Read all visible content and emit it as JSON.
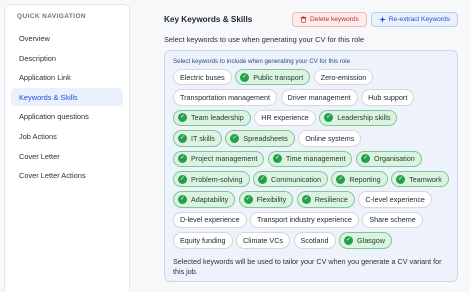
{
  "sidebar": {
    "heading": "QUICK NAVIGATION",
    "items": [
      {
        "label": "Overview"
      },
      {
        "label": "Description"
      },
      {
        "label": "Application Link"
      },
      {
        "label": "Keywords & Skills",
        "active": true
      },
      {
        "label": "Application questions"
      },
      {
        "label": "Job Actions"
      },
      {
        "label": "Cover Letter"
      },
      {
        "label": "Cover Letter Actions"
      }
    ]
  },
  "main": {
    "title": "Key Keywords & Skills",
    "delete_label": "Delete keywords",
    "reextract_label": "Re-extract Keywords",
    "subtitle": "Select keywords to use when generating your CV for this role",
    "panel_caption": "Select keywords to include when generating your CV for this role",
    "keywords": [
      {
        "label": "Electric buses",
        "selected": false
      },
      {
        "label": "Public transport",
        "selected": true
      },
      {
        "label": "Zero-emission",
        "selected": false
      },
      {
        "label": "Transportation management",
        "selected": false
      },
      {
        "label": "Driver management",
        "selected": false
      },
      {
        "label": "Hub support",
        "selected": false
      },
      {
        "label": "Team leadership",
        "selected": true
      },
      {
        "label": "HR experience",
        "selected": false
      },
      {
        "label": "Leadership skills",
        "selected": true
      },
      {
        "label": "IT skills",
        "selected": true
      },
      {
        "label": "Spreadsheets",
        "selected": true
      },
      {
        "label": "Online systems",
        "selected": false
      },
      {
        "label": "Project management",
        "selected": true
      },
      {
        "label": "Time management",
        "selected": true
      },
      {
        "label": "Organisation",
        "selected": true
      },
      {
        "label": "Problem-solving",
        "selected": true
      },
      {
        "label": "Communication",
        "selected": true
      },
      {
        "label": "Reporting",
        "selected": true
      },
      {
        "label": "Teamwork",
        "selected": true
      },
      {
        "label": "Adaptability",
        "selected": true
      },
      {
        "label": "Flexibility",
        "selected": true
      },
      {
        "label": "Resilience",
        "selected": true
      },
      {
        "label": "C-level experience",
        "selected": false
      },
      {
        "label": "D-level experience",
        "selected": false
      },
      {
        "label": "Transport industry experience",
        "selected": false
      },
      {
        "label": "Share scheme",
        "selected": false
      },
      {
        "label": "Equity funding",
        "selected": false
      },
      {
        "label": "Climate VCs",
        "selected": false
      },
      {
        "label": "Scotland",
        "selected": false
      },
      {
        "label": "Glasgow",
        "selected": true
      }
    ],
    "footer": "Selected keywords will be used to tailor your CV when you generate a CV variant for this job."
  },
  "colors": {
    "accent": "#1d4ed8",
    "selected_chip_bg": "#dcf3e2",
    "check_green": "#22a04b",
    "danger": "#c42b2b"
  },
  "icons": {
    "delete": "trash-icon",
    "reextract": "sparkle-icon",
    "selected": "check-circle-icon"
  }
}
